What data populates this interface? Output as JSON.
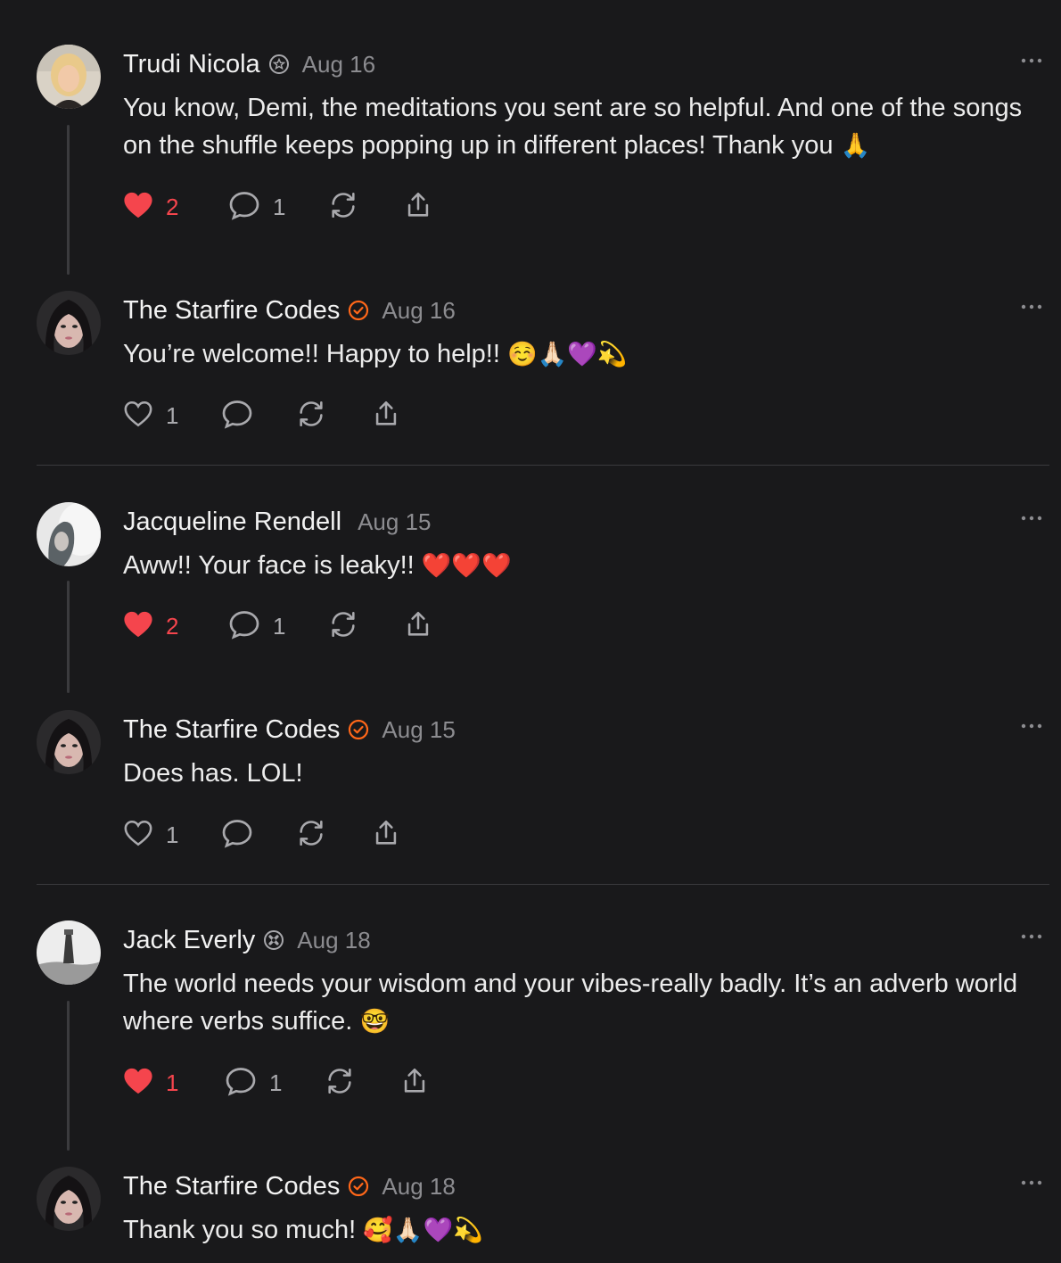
{
  "colors": {
    "background": "#19191b",
    "heart_active": "#f5454d",
    "verified_badge": "#ff6719",
    "muted": "#8c8c90"
  },
  "comments": [
    {
      "author": "Trudi Nicola",
      "badge": "subscriber-badge-icon",
      "date": "Aug 16",
      "text": "You know, Demi, the meditations you sent are so helpful. And one of the songs on the shuffle keeps popping up in different places! Thank you",
      "emoji": "🙏",
      "likes": "2",
      "liked": true,
      "replies": "1"
    },
    {
      "author": "The Starfire Codes",
      "badge": "author-check-icon",
      "date": "Aug 16",
      "text": "You’re welcome!! Happy to help!!",
      "emoji": "☺️🙏🏻💜💫",
      "likes": "1",
      "liked": false,
      "replies": ""
    },
    {
      "author": "Jacqueline Rendell",
      "badge": "",
      "date": "Aug 15",
      "text": "Aww!! Your face is leaky!!",
      "emoji": "❤️❤️❤️",
      "likes": "2",
      "liked": true,
      "replies": "1"
    },
    {
      "author": "The Starfire Codes",
      "badge": "author-check-icon",
      "date": "Aug 15",
      "text": "Does has. LOL!",
      "emoji": "",
      "likes": "1",
      "liked": false,
      "replies": ""
    },
    {
      "author": "Jack Everly",
      "badge": "subscriber-badge-icon",
      "date": "Aug 18",
      "text": "The world needs your wisdom and your vibes-really badly. It’s an adverb world where verbs suffice.",
      "emoji": "🤓",
      "likes": "1",
      "liked": true,
      "replies": "1"
    },
    {
      "author": "The Starfire Codes",
      "badge": "author-check-icon",
      "date": "Aug 18",
      "text": "Thank you so much!",
      "emoji": "🥰🙏🏻💜💫",
      "likes": "",
      "liked": false,
      "replies": ""
    }
  ]
}
